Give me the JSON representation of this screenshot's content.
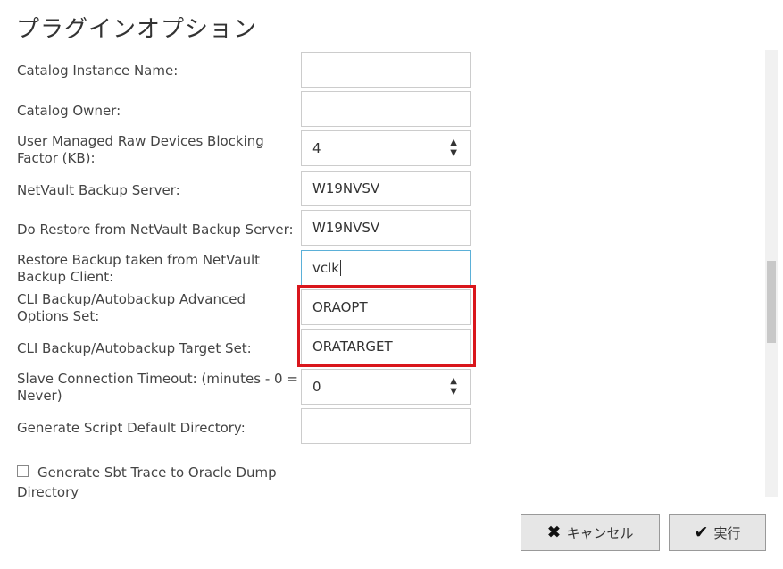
{
  "dialog": {
    "title": "プラグインオプション"
  },
  "fields": [
    {
      "label": "Catalog Instance Name:",
      "value": ""
    },
    {
      "label": "Catalog Owner:",
      "value": ""
    },
    {
      "label": "User Managed Raw Devices Blocking Factor (KB):",
      "value": "4"
    },
    {
      "label": "NetVault Backup Server:",
      "value": "W19NVSV"
    },
    {
      "label": "Do Restore from NetVault Backup Server:",
      "value": "W19NVSV"
    },
    {
      "label": "Restore Backup taken from NetVault Backup Client:",
      "value": "vclk"
    },
    {
      "label": "CLI Backup/Autobackup Advanced Options Set:",
      "value": "ORAOPT"
    },
    {
      "label": "CLI Backup/Autobackup Target Set:",
      "value": "ORATARGET"
    },
    {
      "label": "Slave Connection Timeout: (minutes - 0 = Never)",
      "value": "0"
    },
    {
      "label": "Generate Script Default Directory:",
      "value": ""
    }
  ],
  "checkbox": {
    "label": "Generate Sbt Trace to Oracle Dump Directory",
    "checked": false
  },
  "buttons": {
    "cancel": "キャンセル",
    "ok": "実行"
  },
  "icons": {
    "spinner_up": "▲",
    "spinner_down": "▼",
    "cancel_icon": "✖",
    "ok_icon": "✔"
  },
  "colors": {
    "highlight": "#d9161c",
    "focus_border": "#5bb0d8"
  }
}
